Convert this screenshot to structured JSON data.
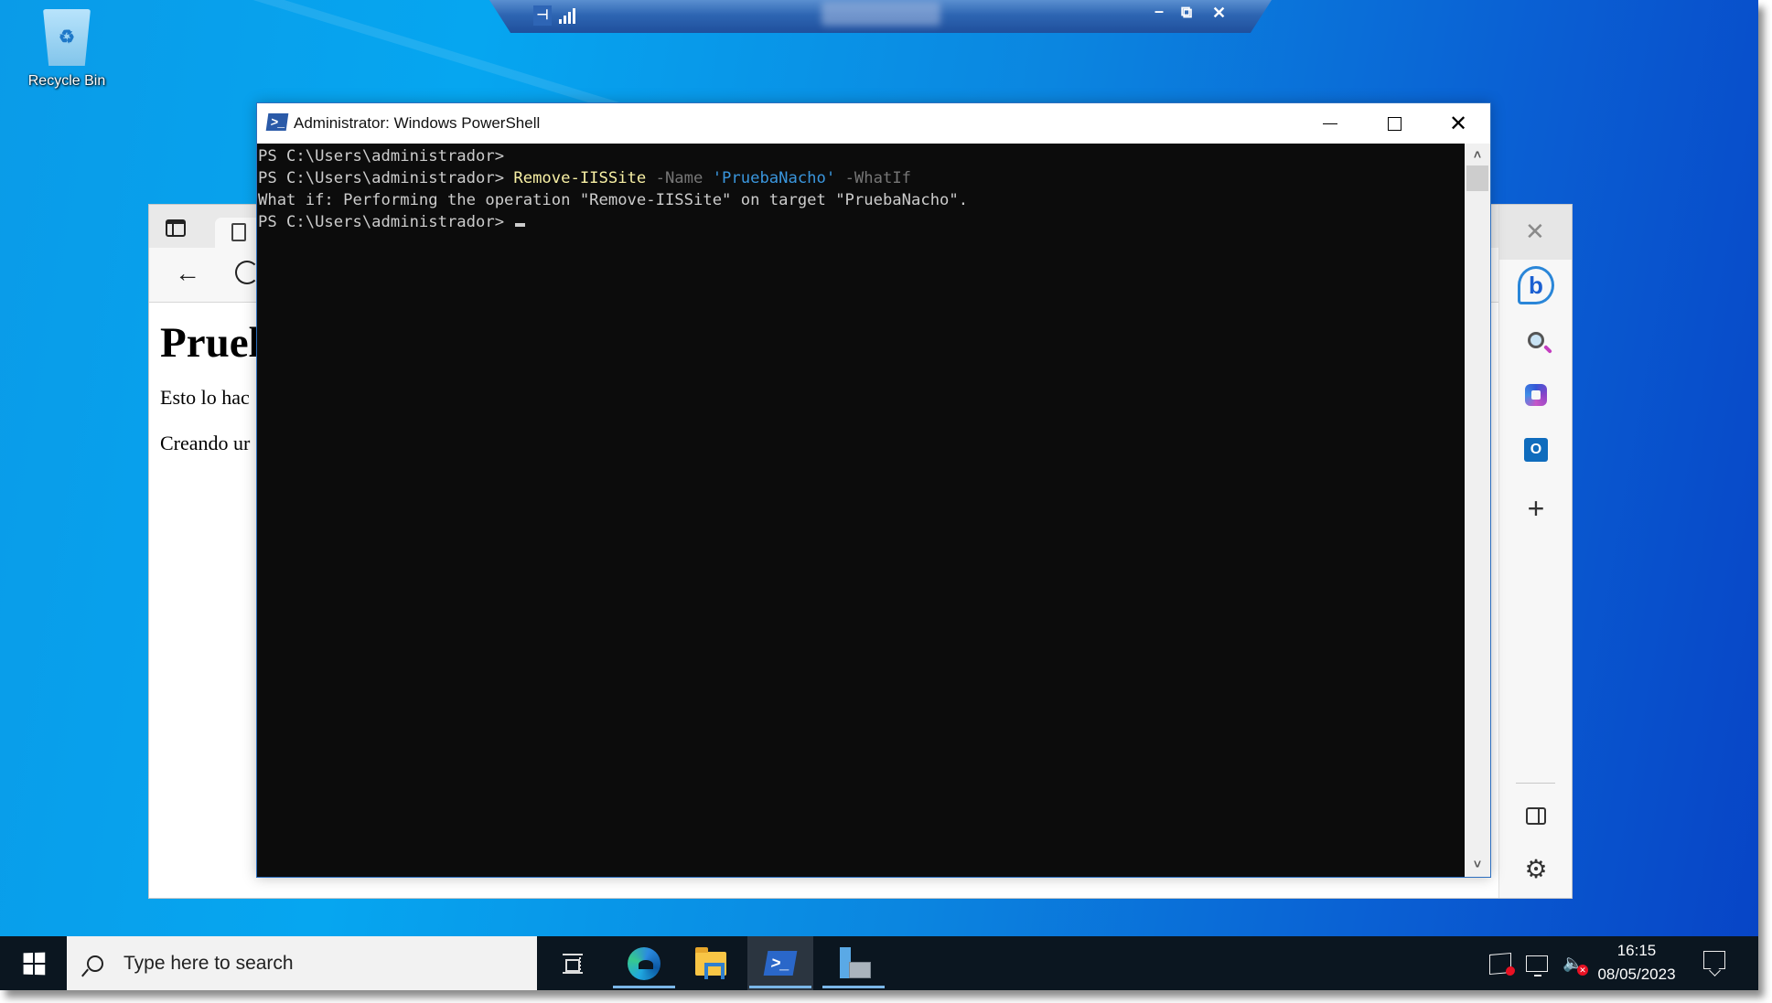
{
  "desktop": {
    "icons": [
      {
        "label": "Recycle Bin",
        "icon": "recycle-bin-icon"
      }
    ]
  },
  "rdp_bar": {
    "pin_icon": "pin-icon",
    "signal_icon": "connection-signal-icon",
    "title": "",
    "minimize": "–",
    "restore": "⧉",
    "close": "✕"
  },
  "browser": {
    "tab_actions_icon": "tab-actions-icon",
    "tab_icon": "page-icon",
    "back": "←",
    "page": {
      "heading": "Pruel",
      "paragraphs": [
        "Esto lo hac",
        "Creando ur"
      ]
    },
    "sidebar": {
      "close": "✕",
      "items": [
        {
          "name": "bing-chat",
          "glyph": "b"
        },
        {
          "name": "search",
          "glyph": ""
        },
        {
          "name": "office",
          "glyph": ""
        },
        {
          "name": "outlook",
          "glyph": "O"
        },
        {
          "name": "add",
          "glyph": "+"
        }
      ],
      "hide_sidebar_icon": "sidebar-toggle-icon",
      "settings_glyph": "⚙"
    }
  },
  "powershell": {
    "title": "Administrator: Windows PowerShell",
    "icon_glyph": ">_",
    "buttons": {
      "close": "✕"
    },
    "lines": [
      {
        "prompt": "PS C:\\Users\\administrador> ",
        "cmd": "",
        "param1": "",
        "str": "",
        "param2": ""
      },
      {
        "prompt": "PS C:\\Users\\administrador> ",
        "cmd": "Remove-IISSite",
        "param1": " -Name ",
        "str": "'PruebaNacho'",
        "param2": " -WhatIf"
      },
      {
        "prompt": "What if: Performing the operation \"Remove-IISSite\" on target \"PruebaNacho\".",
        "cmd": "",
        "param1": "",
        "str": "",
        "param2": ""
      },
      {
        "prompt": "PS C:\\Users\\administrador> ",
        "cmd": "",
        "param1": "",
        "str": "",
        "param2": ""
      }
    ],
    "scroll_up": "˄",
    "scroll_down": "˅"
  },
  "taskbar": {
    "search_placeholder": "Type here to search",
    "apps": [
      {
        "name": "task-view",
        "running": false,
        "active": false
      },
      {
        "name": "microsoft-edge",
        "running": true,
        "active": false
      },
      {
        "name": "file-explorer",
        "running": false,
        "active": false
      },
      {
        "name": "windows-powershell",
        "running": true,
        "active": true
      },
      {
        "name": "server-manager",
        "running": true,
        "active": false
      }
    ],
    "tray": {
      "icons": [
        "sync-error-icon",
        "network-icon",
        "volume-muted-icon"
      ],
      "volume_glyph": "🔈",
      "muted_x": "✕"
    },
    "clock": {
      "time": "16:15",
      "date": "08/05/2023"
    }
  }
}
